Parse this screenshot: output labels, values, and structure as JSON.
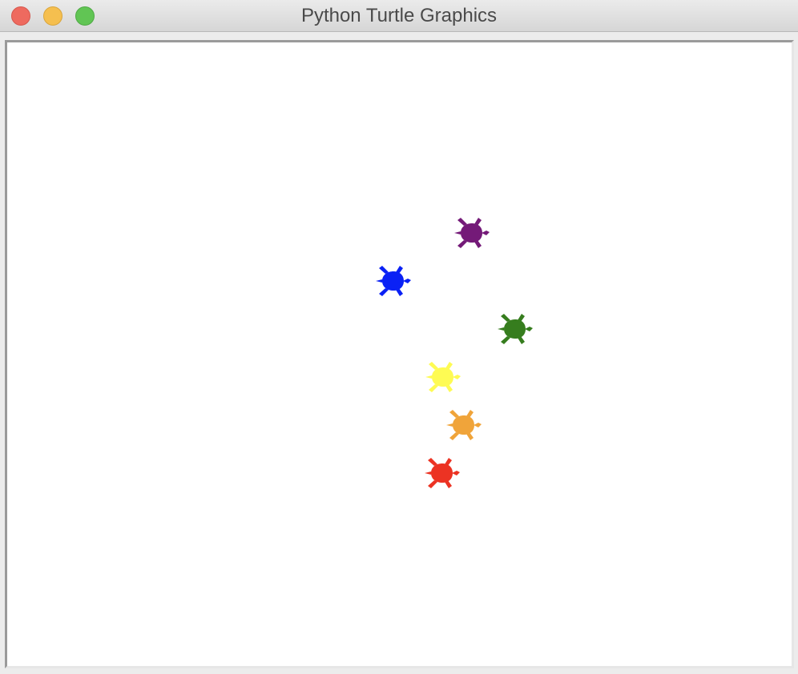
{
  "window": {
    "title": "Python Turtle Graphics"
  },
  "traffic_lights": [
    {
      "name": "close-button",
      "color": "#ee6a5f"
    },
    {
      "name": "minimize-button",
      "color": "#f5bf4f"
    },
    {
      "name": "zoom-button",
      "color": "#61c554"
    }
  ],
  "canvas": {
    "background": "#ffffff",
    "turtles": [
      {
        "name": "turtle-purple",
        "color": "#741a78",
        "heading": "right"
      },
      {
        "name": "turtle-blue",
        "color": "#0a21f5",
        "heading": "right"
      },
      {
        "name": "turtle-green",
        "color": "#367d1e",
        "heading": "right"
      },
      {
        "name": "turtle-yellow",
        "color": "#fefb53",
        "heading": "right"
      },
      {
        "name": "turtle-orange",
        "color": "#f0a43a",
        "heading": "right"
      },
      {
        "name": "turtle-red",
        "color": "#ec3323",
        "heading": "right"
      }
    ]
  }
}
